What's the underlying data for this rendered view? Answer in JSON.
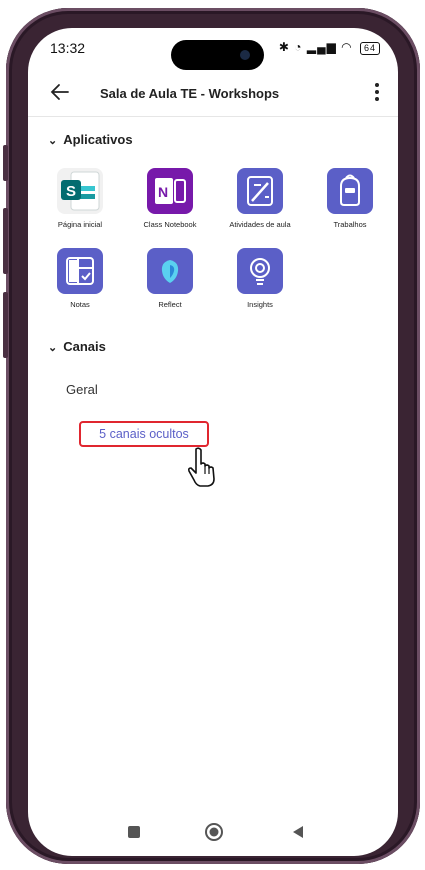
{
  "status": {
    "time": "13:32",
    "battery": "64"
  },
  "header": {
    "title": "Sala de Aula TE - Workshops"
  },
  "sections": {
    "apps_label": "Aplicativos",
    "channels_label": "Canais"
  },
  "apps": [
    {
      "label": "Página inicial",
      "icon": "sharepoint-icon"
    },
    {
      "label": "Class Notebook",
      "icon": "onenote-icon"
    },
    {
      "label": "Atividades de aula",
      "icon": "activities-icon"
    },
    {
      "label": "Trabalhos",
      "icon": "backpack-icon"
    },
    {
      "label": "Notas",
      "icon": "grades-icon"
    },
    {
      "label": "Reflect",
      "icon": "reflect-icon"
    },
    {
      "label": "Insights",
      "icon": "insights-icon"
    }
  ],
  "channels": {
    "general": "Geral",
    "hidden": "5 canais ocultos"
  },
  "colors": {
    "accent": "#5b5fc7",
    "highlight": "#e0262f",
    "sharepoint": "#036c70",
    "onenote": "#7719aa"
  }
}
